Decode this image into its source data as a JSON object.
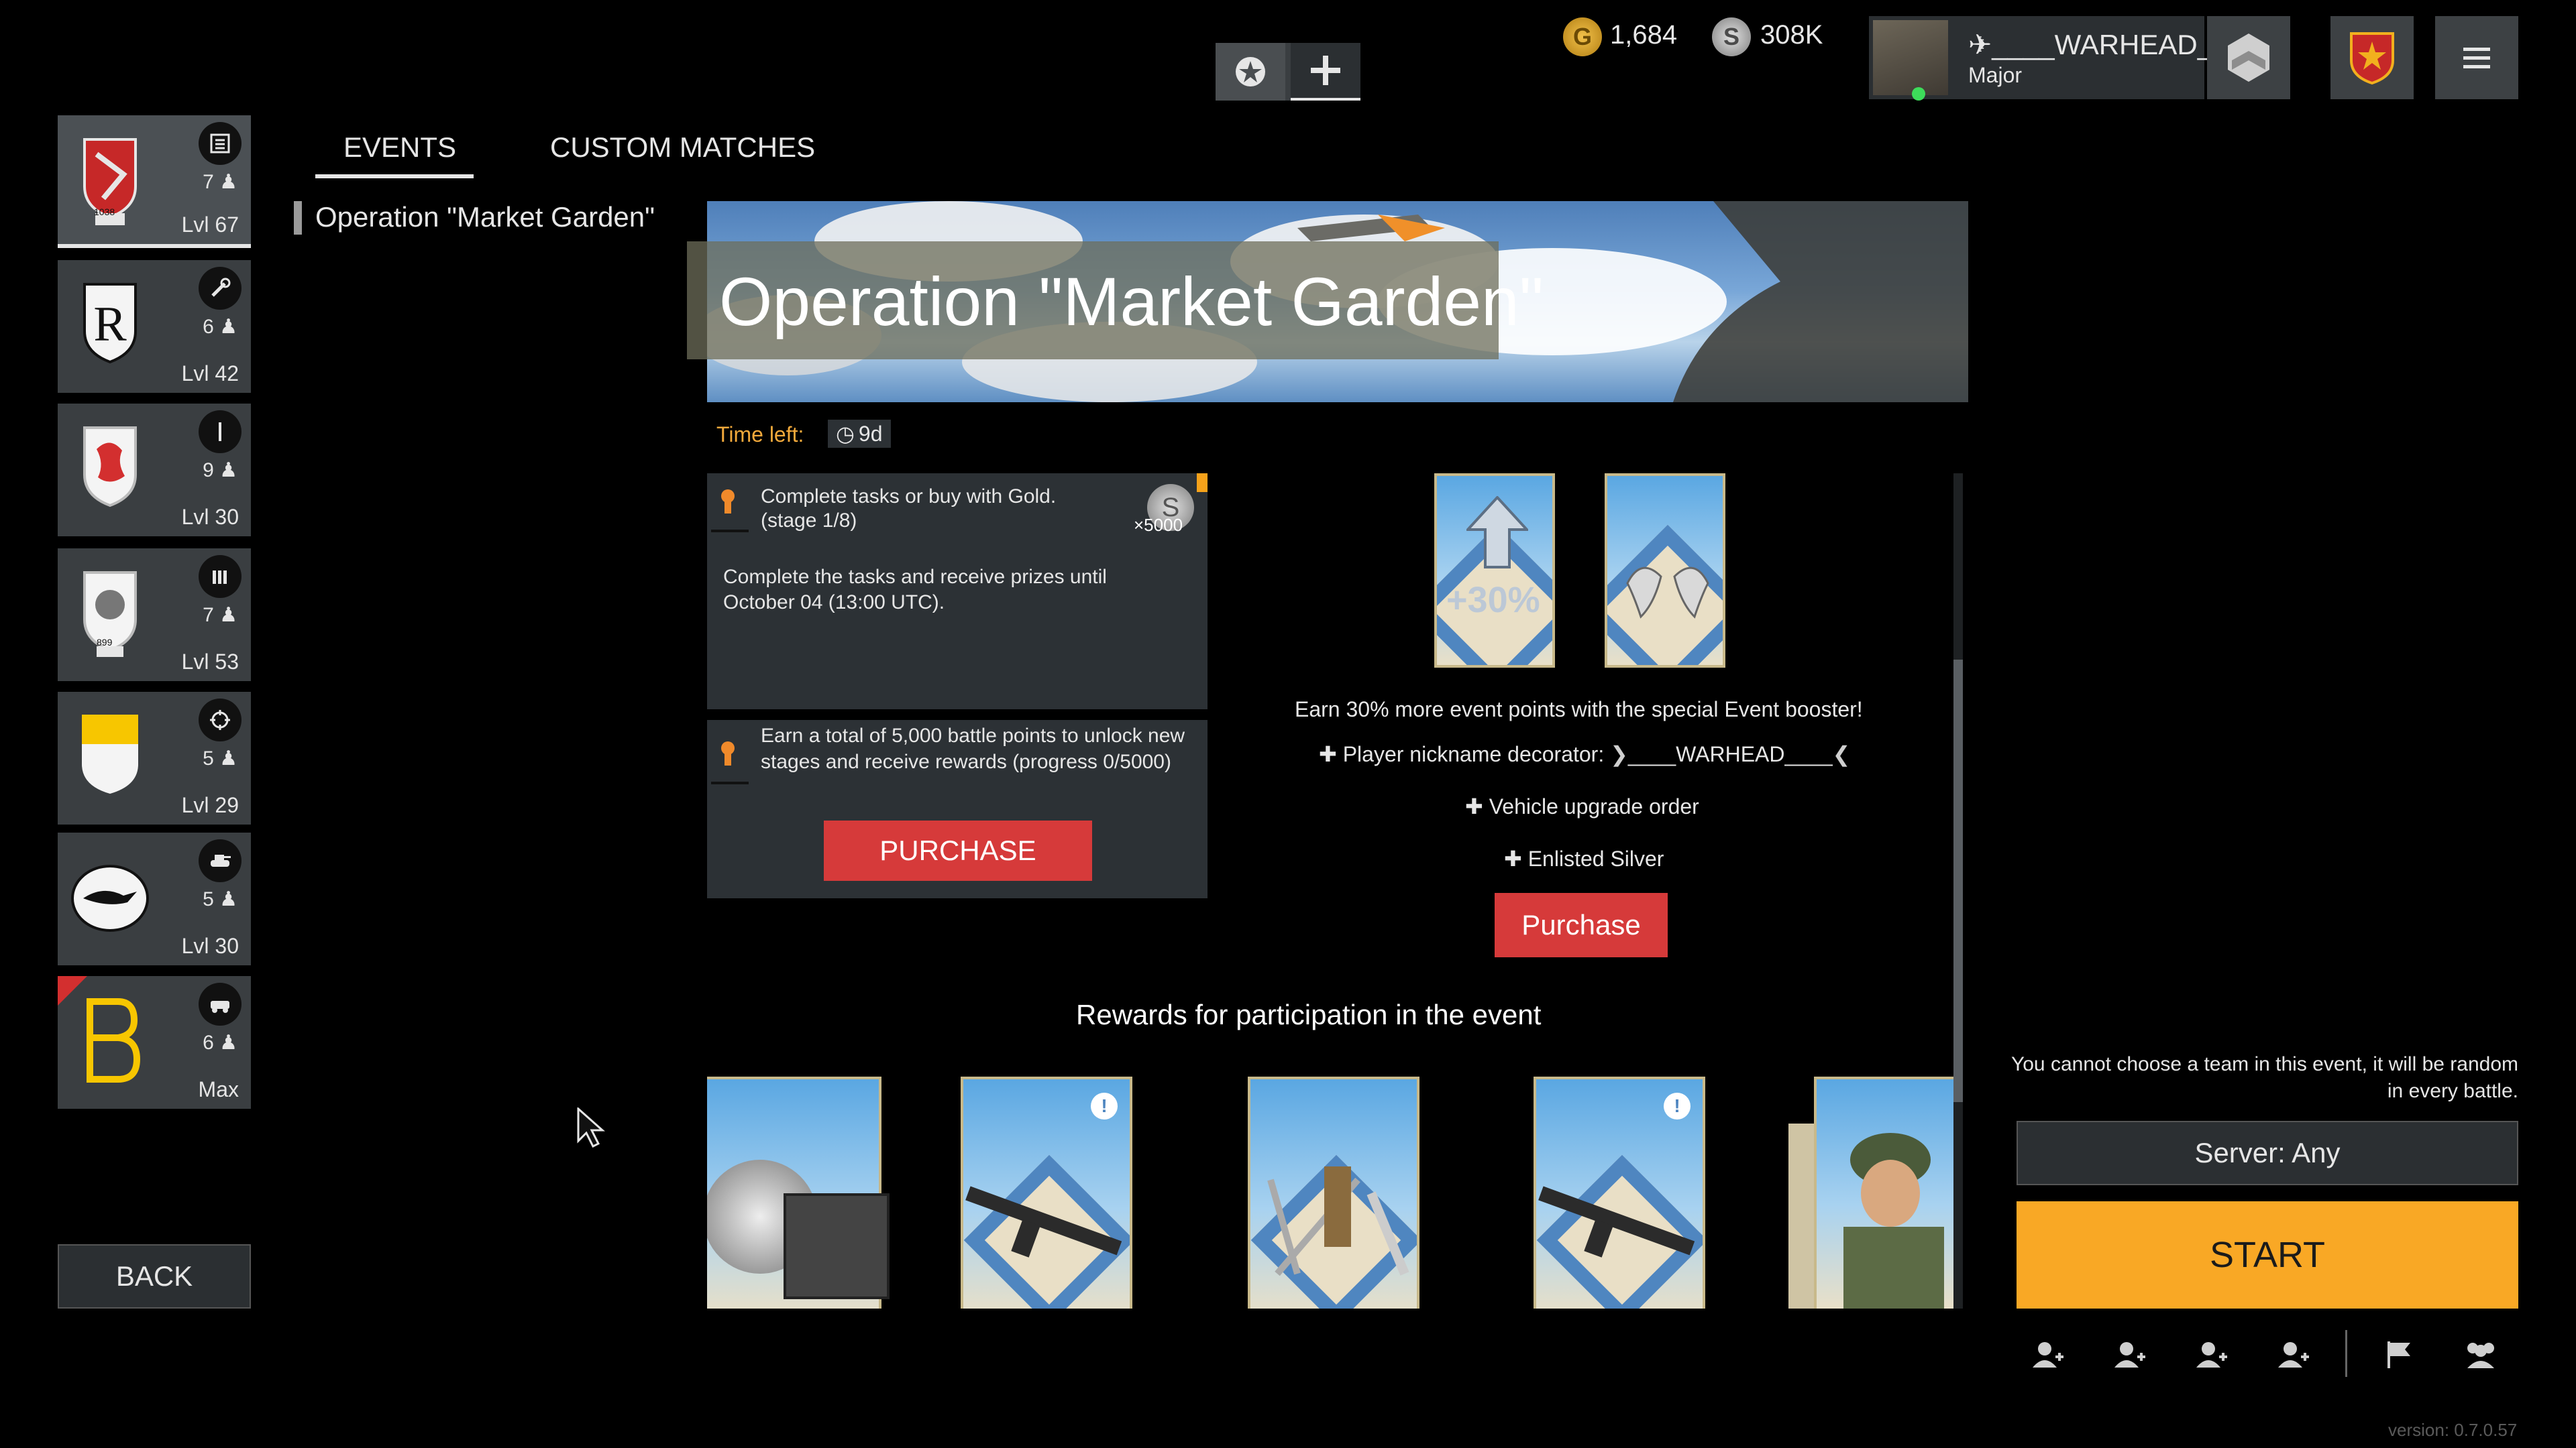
{
  "top": {
    "gold": "1,684",
    "silver": "308K",
    "player_name": "WARHEAD",
    "player_prefix": "✈____",
    "player_suffix": "__",
    "rank": "Major"
  },
  "tabs": {
    "events": "EVENTS",
    "custom_matches": "CUSTOM MATCHES"
  },
  "event_list": [
    {
      "label": "Operation \"Market Garden\""
    }
  ],
  "squads": [
    {
      "count": "7",
      "level": "Lvl 67",
      "badge": "1038"
    },
    {
      "count": "6",
      "level": "Lvl 42"
    },
    {
      "count": "9",
      "level": "Lvl 30"
    },
    {
      "count": "7",
      "level": "Lvl 53",
      "badge": "899"
    },
    {
      "count": "5",
      "level": "Lvl 29"
    },
    {
      "count": "5",
      "level": "Lvl 30"
    },
    {
      "count": "6",
      "level": "Max"
    }
  ],
  "back_label": "BACK",
  "event": {
    "title": "Operation \"Market Garden\"",
    "time_left_label": "Time left:",
    "time_left_value": "9d",
    "task1_title": "Complete tasks or buy with Gold.",
    "task1_stage": "(stage 1/8)",
    "task1_reward": "×5000",
    "task1_desc": "Complete the tasks and receive prizes until October 04 (13:00 UTC).",
    "task2_desc": "Earn a total of 5,000 battle points to unlock new stages and receive rewards (progress 0/5000)",
    "purchase_upper": "PURCHASE",
    "booster_percent": "+30%",
    "booster_text": "Earn 30% more event points with the special Event booster!",
    "perks": [
      "Player nickname decorator:",
      "Vehicle upgrade order",
      "Enlisted Silver"
    ],
    "nickname_decorated": "____WARHEAD____",
    "purchase_label": "Purchase",
    "rewards_heading": "Rewards for participation in the event"
  },
  "right": {
    "team_note": "You cannot choose a team in this event, it will be random in every battle.",
    "server_label": "Server: Any",
    "start_label": "START"
  },
  "version": "version: 0.7.0.57",
  "colors": {
    "accent_yellow": "#f9a825",
    "purchase_red": "#d63a3a",
    "panel": "#2c3135"
  }
}
